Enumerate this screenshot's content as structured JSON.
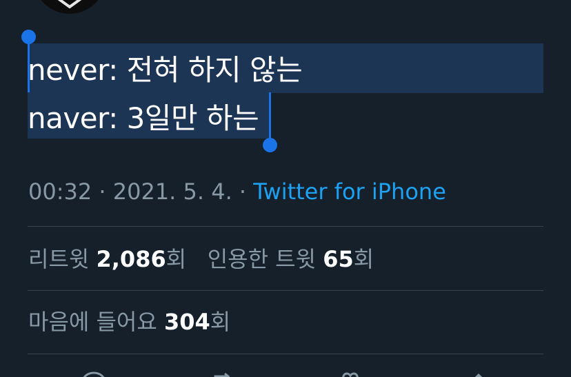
{
  "tweet": {
    "line1": "never: 전혀 하지 않는",
    "line2": "naver: 3일만 하는"
  },
  "meta": {
    "time": "00:32",
    "separator": " · ",
    "date": "2021. 5. 4.",
    "source": "Twitter for iPhone"
  },
  "stats": {
    "retweet_label": "리트윗",
    "retweet_count": "2,086",
    "retweet_unit": "회",
    "quote_label": "인용한 트윗",
    "quote_count": "65",
    "quote_unit": "회",
    "like_label": "마음에 들어요",
    "like_count": "304",
    "like_unit": "회"
  },
  "actions": [
    "reply-icon",
    "retweet-icon",
    "like-icon",
    "share-icon"
  ],
  "colors": {
    "background": "#15202b",
    "selection": "#1d3a5c",
    "handle": "#1a73e8",
    "link": "#1da1f2",
    "muted": "#8899a6",
    "divider": "#38444d"
  }
}
